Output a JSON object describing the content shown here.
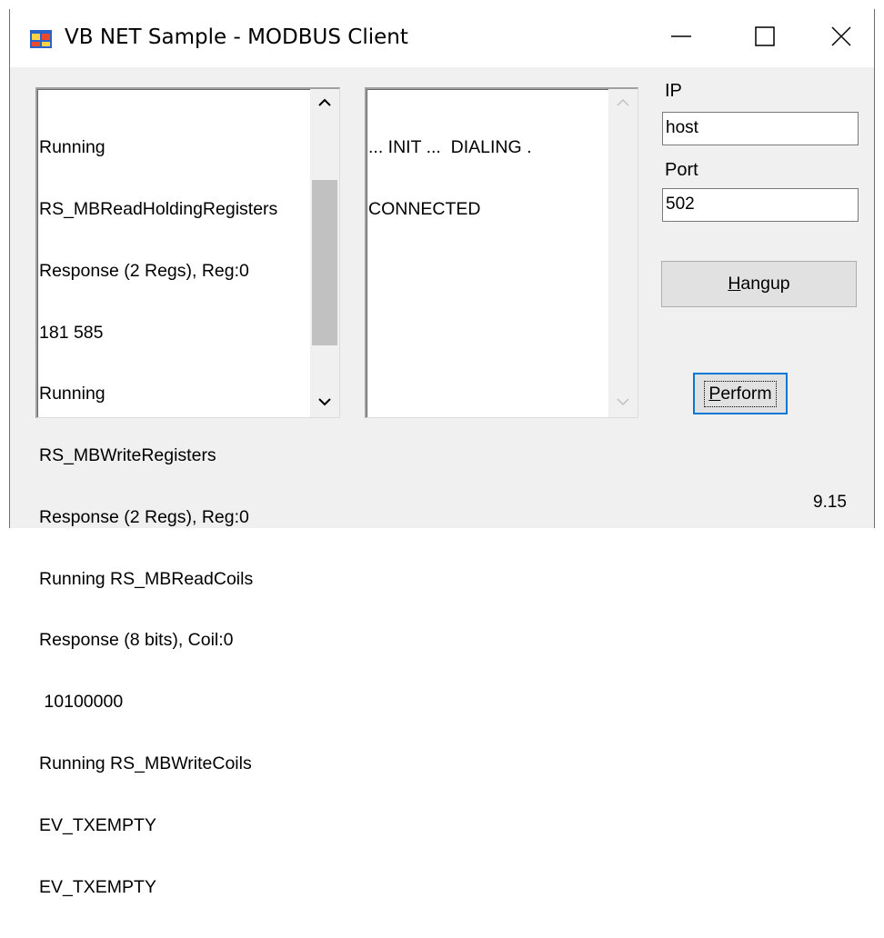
{
  "window": {
    "title": "VB NET Sample - MODBUS Client",
    "app_icon": "windows-form-icon"
  },
  "titlebar_controls": {
    "minimize_icon": "minimize-icon",
    "maximize_icon": "maximize-icon",
    "close_icon": "close-icon"
  },
  "log_list": {
    "lines": [
      "Running",
      "RS_MBReadHoldingRegisters",
      "Response (2 Regs), Reg:0",
      "181 585",
      "Running",
      "RS_MBWriteRegisters",
      "Response (2 Regs), Reg:0",
      "Running RS_MBReadCoils",
      "Response (8 bits), Coil:0",
      " 10100000",
      "Running RS_MBWriteCoils",
      "EV_TXEMPTY",
      "EV_TXEMPTY"
    ],
    "scroll_position": 0.62
  },
  "status_list": {
    "lines": [
      "... INIT ...  DIALING .",
      "CONNECTED"
    ]
  },
  "connection": {
    "ip_label": "IP",
    "ip_value": "host",
    "port_label": "Port",
    "port_value": "502"
  },
  "buttons": {
    "hangup_accel": "H",
    "hangup_rest": "angup",
    "perform_accel": "P",
    "perform_rest": "erform"
  },
  "version": "9.15",
  "colors": {
    "window_bg": "#f0f0f0",
    "focus_border": "#0078d7",
    "button_bg": "#e1e1e1"
  }
}
